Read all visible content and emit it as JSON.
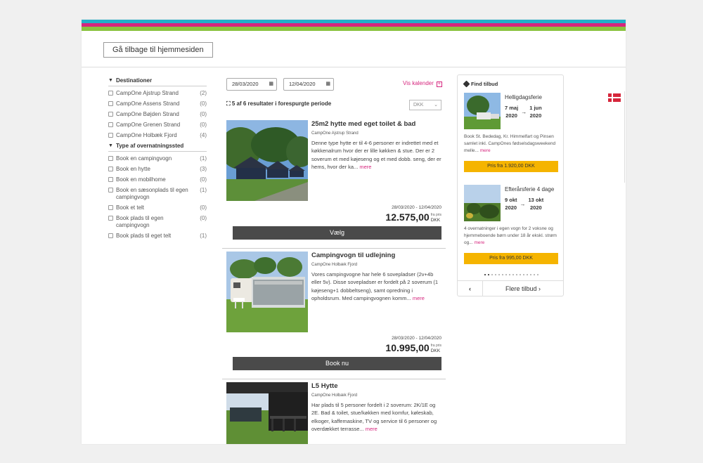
{
  "header": {
    "back_button": "Gå tilbage til hjemmesiden"
  },
  "filters": {
    "destinations": {
      "title": "Destinationer",
      "items": [
        {
          "label": "CampOne Ajstrup Strand",
          "count": "(2)"
        },
        {
          "label": "CampOne Assens Strand",
          "count": "(0)"
        },
        {
          "label": "CampOne Bøjden Strand",
          "count": "(0)"
        },
        {
          "label": "CampOne Grenen Strand",
          "count": "(0)"
        },
        {
          "label": "CampOne Holbæk Fjord",
          "count": "(4)"
        }
      ]
    },
    "types": {
      "title": "Type af overnatningssted",
      "items": [
        {
          "label": "Book en campingvogn",
          "count": "(1)"
        },
        {
          "label": "Book en hytte",
          "count": "(3)"
        },
        {
          "label": "Book en mobilhome",
          "count": "(0)"
        },
        {
          "label": "Book en sæsonplads til egen campingvogn",
          "count": "(1)"
        },
        {
          "label": "Book et telt",
          "count": "(0)"
        },
        {
          "label": "Book plads til egen campingvogn",
          "count": "(0)"
        },
        {
          "label": "Book plads til eget telt",
          "count": "(1)"
        }
      ]
    }
  },
  "search": {
    "date_from": "28/03/2020",
    "date_to": "12/04/2020",
    "calendar_link": "Vis kalender",
    "results_text": "5 af 6 resultater i forespurgte periode",
    "currency": "DKK"
  },
  "listings": [
    {
      "title": "25m2 hytte med eget toilet & bad",
      "site": "CampOne Ajstrup Strand",
      "desc": "Denne type hytte er til 4-6 personer er indrettet med et køkkenalrum hvor der er lille køkken & stue. Der er 2 soverum et med køjeseng og et med dobb. seng, der er hems, hvor der ka...",
      "more": "mere",
      "dates": "28/03/2020 - 12/04/2020",
      "from": "fra pris",
      "price": "12.575,00",
      "currency": "DKK",
      "button": "Vælg"
    },
    {
      "title": "Campingvogn til udlejning",
      "site": "CampOne Holbæk Fjord",
      "desc": "Vores campingvogne har hele 6 sovepladser (2v+4b eller 5v). Disse sovepladser er fordelt på 2 soverum (1 køjeseng+1 dobbeltseng), samt opredning i opholdsrum. Med campingvognen komm...",
      "more": "mere",
      "dates": "28/03/2020 - 12/04/2020",
      "from": "fra pris",
      "price": "10.995,00",
      "currency": "DKK",
      "button": "Book nu"
    },
    {
      "title": "L5 Hytte",
      "site": "CampOne Holbæk Fjord",
      "desc": "Har plads til 5 personer fordelt i 2 soverum: 2K/1E og 2E. Bad & toilet, stue/køkken med komfur, køleskab, elkoger, kaffemaskine, TV og service til 6 personer og overdækket terrasse...",
      "more": "mere"
    }
  ],
  "offers": {
    "title": "Find tilbud",
    "items": [
      {
        "title": "Helligdagsferie",
        "start_day": "7 maj",
        "start_year": "2020",
        "end_day": "1 jun",
        "end_year": "2020",
        "desc": "Book St. Bededag, Kr. Himmelfart og Pinsen samlet inkl. CampOnes fødselsdagsweekend melle...",
        "more": "mere",
        "price": "Pris fra 1.920,00 DKK"
      },
      {
        "title": "Efterårsferie 4 dage",
        "start_day": "9 okt",
        "start_year": "2020",
        "end_day": "13 okt",
        "end_year": "2020",
        "desc": "4 overnatninger i egen vogn for 2 voksne og hjemmeboende børn under 18 år ekskl. strøm og...",
        "more": "mere",
        "price": "Pris fra 995,00 DKK"
      }
    ],
    "more_offers": "Flere tilbud"
  }
}
